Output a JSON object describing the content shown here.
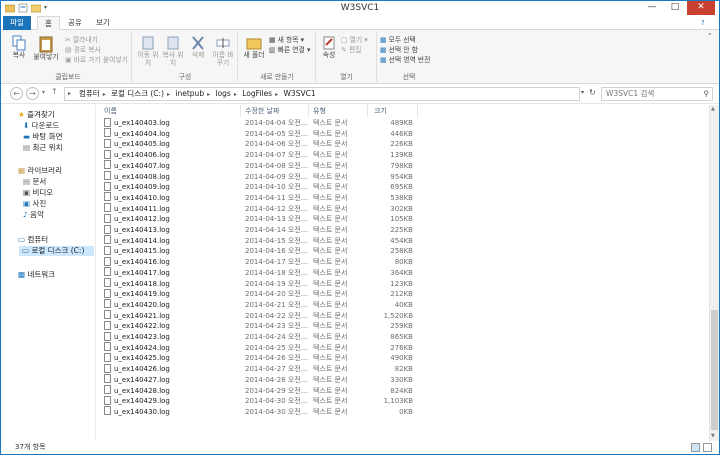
{
  "window": {
    "title": "W3SVC1",
    "min": "—",
    "max": "□",
    "close": "✕"
  },
  "tabs": {
    "file": "파일",
    "home": "홈",
    "share": "공유",
    "view": "보기"
  },
  "ribbon": {
    "copy": "복사",
    "paste": "붙여넣기",
    "cut": "잘라내기",
    "copy_path": "경로 복사",
    "paste_shortcut": "바로 가기 붙여넣기",
    "clipboard": "클립보드",
    "move_to": "이동 위치",
    "copy_to": "복사 위치",
    "delete": "삭제",
    "rename": "이름 바꾸기",
    "organize": "구성",
    "new_folder": "새 폴더",
    "new_item": "새 항목",
    "easy_access": "빠른 연결",
    "new": "새로 만들기",
    "properties": "속성",
    "open": "열기",
    "edit": "편집",
    "open_group": "열기",
    "select_all": "모두 선택",
    "select_none": "선택 안 함",
    "invert": "선택 영역 반전",
    "select": "선택"
  },
  "address": {
    "crumbs": [
      "컴퓨터",
      "로컬 디스크 (C:)",
      "inetpub",
      "logs",
      "LogFiles",
      "W3SVC1"
    ],
    "search_placeholder": "W3SVC1 검색"
  },
  "nav": {
    "favorites": "즐겨찾기",
    "downloads": "다운로드",
    "desktop": "바탕 화면",
    "recent": "최근 위치",
    "libraries": "라이브러리",
    "documents": "문서",
    "videos": "비디오",
    "pictures": "사진",
    "music": "음악",
    "computer": "컴퓨터",
    "local_disk": "로컬 디스크 (C:)",
    "network": "네트워크"
  },
  "columns": {
    "name": "이름",
    "date": "수정한 날짜",
    "type": "유형",
    "size": "크기"
  },
  "files": [
    {
      "name": "u_ex140403.log",
      "date": "2014-04-04 오전...",
      "type": "텍스트 문서",
      "size": "489KB"
    },
    {
      "name": "u_ex140404.log",
      "date": "2014-04-05 오전...",
      "type": "텍스트 문서",
      "size": "446KB"
    },
    {
      "name": "u_ex140405.log",
      "date": "2014-04-06 오전...",
      "type": "텍스트 문서",
      "size": "226KB"
    },
    {
      "name": "u_ex140406.log",
      "date": "2014-04-07 오전...",
      "type": "텍스트 문서",
      "size": "139KB"
    },
    {
      "name": "u_ex140407.log",
      "date": "2014-04-08 오전...",
      "type": "텍스트 문서",
      "size": "798KB"
    },
    {
      "name": "u_ex140408.log",
      "date": "2014-04-09 오전...",
      "type": "텍스트 문서",
      "size": "954KB"
    },
    {
      "name": "u_ex140409.log",
      "date": "2014-04-10 오전...",
      "type": "텍스트 문서",
      "size": "695KB"
    },
    {
      "name": "u_ex140410.log",
      "date": "2014-04-11 오전...",
      "type": "텍스트 문서",
      "size": "538KB"
    },
    {
      "name": "u_ex140411.log",
      "date": "2014-04-12 오전...",
      "type": "텍스트 문서",
      "size": "302KB"
    },
    {
      "name": "u_ex140412.log",
      "date": "2014-04-13 오전...",
      "type": "텍스트 문서",
      "size": "105KB"
    },
    {
      "name": "u_ex140413.log",
      "date": "2014-04-14 오전...",
      "type": "텍스트 문서",
      "size": "225KB"
    },
    {
      "name": "u_ex140414.log",
      "date": "2014-04-15 오전...",
      "type": "텍스트 문서",
      "size": "454KB"
    },
    {
      "name": "u_ex140415.log",
      "date": "2014-04-16 오전...",
      "type": "텍스트 문서",
      "size": "258KB"
    },
    {
      "name": "u_ex140416.log",
      "date": "2014-04-17 오전...",
      "type": "텍스트 문서",
      "size": "80KB"
    },
    {
      "name": "u_ex140417.log",
      "date": "2014-04-18 오전...",
      "type": "텍스트 문서",
      "size": "364KB"
    },
    {
      "name": "u_ex140418.log",
      "date": "2014-04-19 오전...",
      "type": "텍스트 문서",
      "size": "123KB"
    },
    {
      "name": "u_ex140419.log",
      "date": "2014-04-20 오전...",
      "type": "텍스트 문서",
      "size": "212KB"
    },
    {
      "name": "u_ex140420.log",
      "date": "2014-04-21 오전...",
      "type": "텍스트 문서",
      "size": "40KB"
    },
    {
      "name": "u_ex140421.log",
      "date": "2014-04-22 오전...",
      "type": "텍스트 문서",
      "size": "1,520KB"
    },
    {
      "name": "u_ex140422.log",
      "date": "2014-04-23 오전...",
      "type": "텍스트 문서",
      "size": "259KB"
    },
    {
      "name": "u_ex140423.log",
      "date": "2014-04-24 오전...",
      "type": "텍스트 문서",
      "size": "865KB"
    },
    {
      "name": "u_ex140424.log",
      "date": "2014-04-25 오전...",
      "type": "텍스트 문서",
      "size": "276KB"
    },
    {
      "name": "u_ex140425.log",
      "date": "2014-04-26 오전...",
      "type": "텍스트 문서",
      "size": "490KB"
    },
    {
      "name": "u_ex140426.log",
      "date": "2014-04-27 오전...",
      "type": "텍스트 문서",
      "size": "82KB"
    },
    {
      "name": "u_ex140427.log",
      "date": "2014-04-28 오전...",
      "type": "텍스트 문서",
      "size": "330KB"
    },
    {
      "name": "u_ex140428.log",
      "date": "2014-04-29 오전...",
      "type": "텍스트 문서",
      "size": "824KB"
    },
    {
      "name": "u_ex140429.log",
      "date": "2014-04-30 오전...",
      "type": "텍스트 문서",
      "size": "1,103KB"
    },
    {
      "name": "u_ex140430.log",
      "date": "2014-04-30 오전...",
      "type": "텍스트 문서",
      "size": "0KB"
    }
  ],
  "status": {
    "count": "37개 항목"
  },
  "colors": {
    "accent": "#1b73ba",
    "close": "#c7412e",
    "selection": "#cce8ff"
  }
}
